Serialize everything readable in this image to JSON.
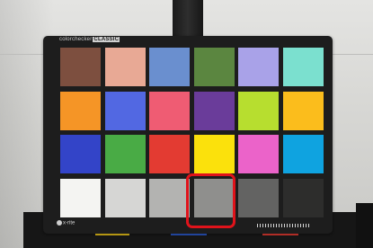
{
  "card": {
    "brand_text": "colorchecker",
    "model_badge": "CLASSIC",
    "maker_text": "x-rite"
  },
  "colors": {
    "highlight": "#e0131b",
    "card_body": "#1d1d1d"
  },
  "patches": [
    {
      "name": "dark-skin",
      "color": "#7d4f3f"
    },
    {
      "name": "light-skin",
      "color": "#e8a995"
    },
    {
      "name": "blue-sky",
      "color": "#6a8fcf"
    },
    {
      "name": "foliage",
      "color": "#5b8640"
    },
    {
      "name": "blue-flower",
      "color": "#a9a2e8"
    },
    {
      "name": "bluish-green",
      "color": "#7be0cf"
    },
    {
      "name": "orange",
      "color": "#f59526"
    },
    {
      "name": "purplish-blue",
      "color": "#5268e2"
    },
    {
      "name": "moderate-red",
      "color": "#ef5c73"
    },
    {
      "name": "purple",
      "color": "#6a3c9a"
    },
    {
      "name": "yellow-green",
      "color": "#b7de2f"
    },
    {
      "name": "orange-yellow",
      "color": "#fbbd1c"
    },
    {
      "name": "blue",
      "color": "#3344c8"
    },
    {
      "name": "green",
      "color": "#49ab45"
    },
    {
      "name": "red",
      "color": "#e33b32"
    },
    {
      "name": "yellow",
      "color": "#fbe10c"
    },
    {
      "name": "magenta",
      "color": "#eb63c9"
    },
    {
      "name": "cyan",
      "color": "#0fa3e0"
    },
    {
      "name": "white",
      "color": "#f4f4f2"
    },
    {
      "name": "neutral-8",
      "color": "#d6d6d4"
    },
    {
      "name": "neutral-6-5",
      "color": "#b3b3b1"
    },
    {
      "name": "neutral-5",
      "color": "#8f8f8d"
    },
    {
      "name": "neutral-3-5",
      "color": "#636362"
    },
    {
      "name": "black",
      "color": "#2d2d2c"
    }
  ],
  "highlighted_patch": "neutral-5",
  "floor_strips": [
    {
      "color": "#e8c21a"
    },
    {
      "color": "#2b58c8"
    },
    {
      "color": "#e33b32"
    }
  ]
}
